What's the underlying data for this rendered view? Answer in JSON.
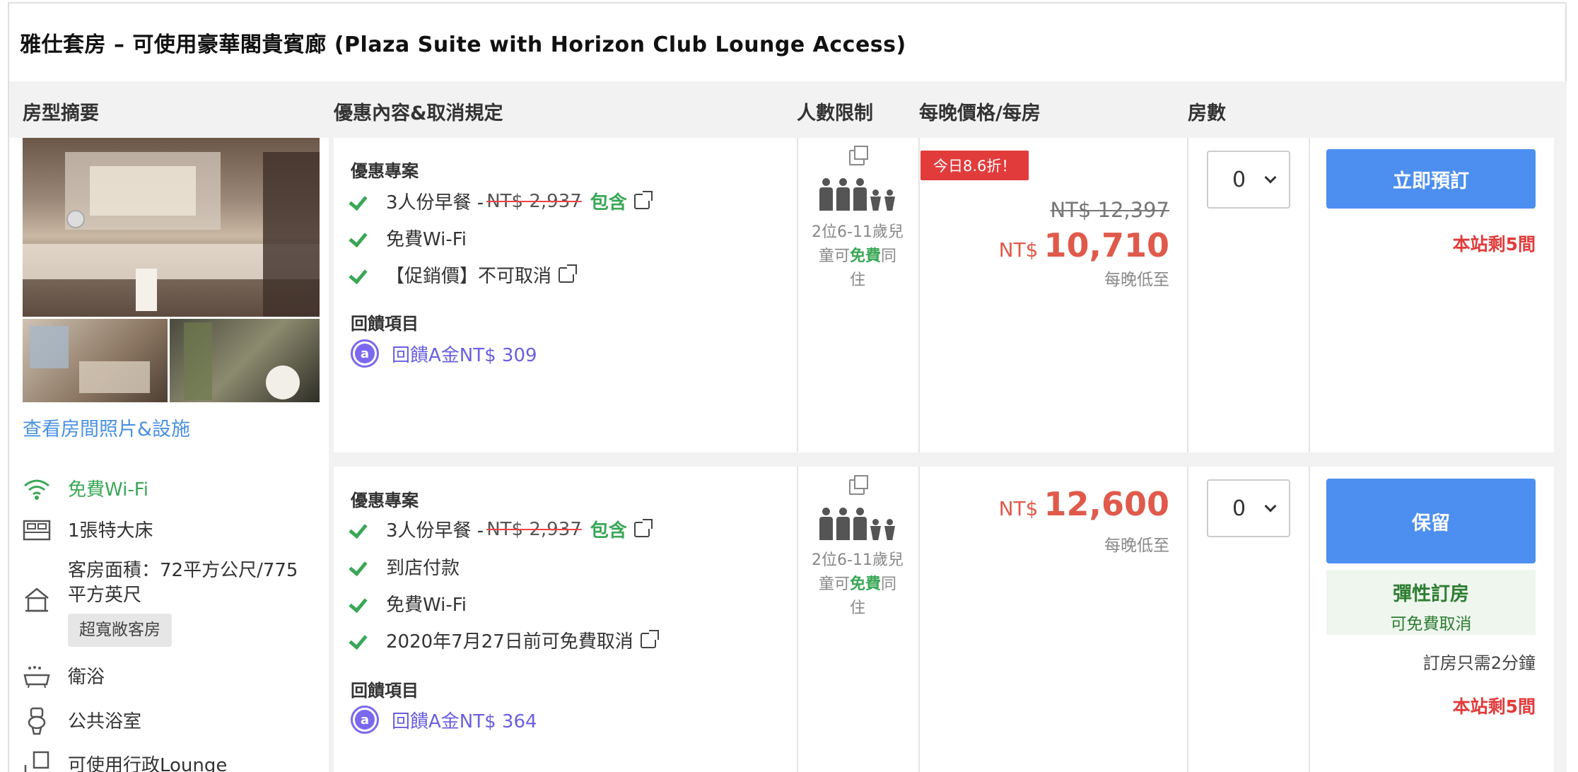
{
  "room": {
    "title": "雅仕套房 – 可使用豪華閣貴賓廊 (Plaza Suite with Horizon Club Lounge Access)",
    "photos_link": "查看房間照片&設施",
    "amenities": [
      {
        "icon": "wifi-icon",
        "label": "免費Wi-Fi",
        "highlight": true
      },
      {
        "icon": "bed-icon",
        "label": "1張特大床"
      },
      {
        "icon": "house-icon",
        "label": "客房面積：72平方公尺/775平方英尺",
        "tag": "超寬敞客房"
      },
      {
        "icon": "bathtub-icon",
        "label": "衛浴"
      },
      {
        "icon": "toilet-icon",
        "label": "公共浴室"
      },
      {
        "icon": "lounge-icon",
        "label": "可使用行政Lounge"
      }
    ]
  },
  "columns": {
    "summary": "房型摘要",
    "offer": "優惠內容&取消規定",
    "occupancy": "人數限制",
    "price": "每晚價格/每房",
    "rooms": "房數"
  },
  "offers": [
    {
      "section_title": "優惠專案",
      "breakfast_label": "3人份早餐 -",
      "breakfast_old": "NT$ 2,937",
      "breakfast_included": "包含",
      "benefits": [
        "免費Wi-Fi",
        "【促銷價】不可取消"
      ],
      "rewards_title": "回饋項目",
      "reward_text": "回饋A金NT$ 309",
      "kid_note_a": "2位6-11歲兒",
      "kid_note_b": "童可",
      "kid_note_free": "免費",
      "kid_note_c": "同",
      "kid_note_d": "住",
      "discount_badge": "今日8.6折！",
      "price_old": "NT$ 12,397",
      "currency": "NT$",
      "price": "10,710",
      "per_night": "每晚低至",
      "room_count": "0",
      "button_label": "立即預訂",
      "remaining": "本站剩5間"
    },
    {
      "section_title": "優惠專案",
      "breakfast_label": "3人份早餐 -",
      "breakfast_old": "NT$ 2,937",
      "breakfast_included": "包含",
      "benefits": [
        "到店付款",
        "免費Wi-Fi",
        "2020年7月27日前可免費取消"
      ],
      "rewards_title": "回饋項目",
      "reward_text": "回饋A金NT$ 364",
      "kid_note_a": "2位6-11歲兒",
      "kid_note_b": "童可",
      "kid_note_free": "免費",
      "kid_note_c": "同",
      "kid_note_d": "住",
      "currency": "NT$",
      "price": "12,600",
      "per_night": "每晚低至",
      "room_count": "0",
      "button_label": "保留",
      "flex_title": "彈性訂房",
      "flex_sub": "可免費取消",
      "quick_note": "訂房只需2分鐘",
      "remaining": "本站剩5間"
    }
  ],
  "colors": {
    "accent_blue": "#4c8ff0",
    "price_red": "#e05a4b",
    "include_green": "#3aa757",
    "reward_purple": "#6a5fe0"
  }
}
